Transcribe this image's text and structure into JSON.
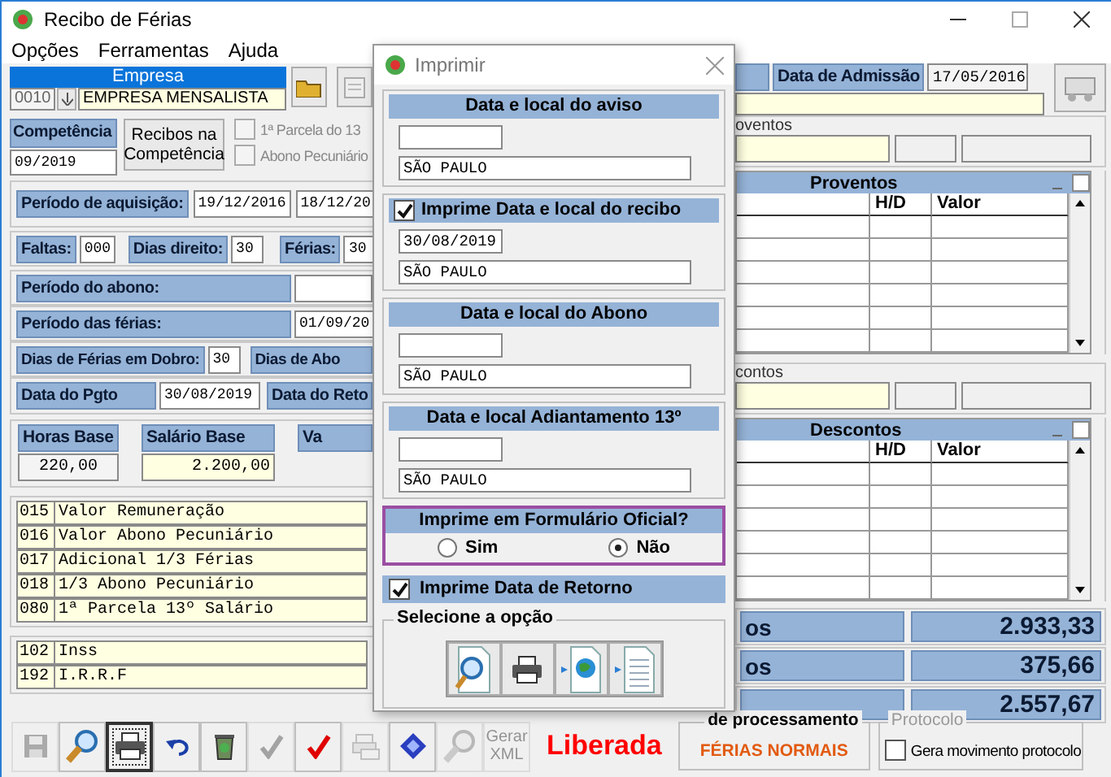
{
  "window": {
    "title": "Recibo de Férias"
  },
  "menu": [
    "Opções",
    "Ferramentas",
    "Ajuda"
  ],
  "empresa": {
    "label": "Empresa",
    "code": "0010",
    "name": "EMPRESA MENSALISTA"
  },
  "competencia": {
    "label": "Competência",
    "value": "09/2019",
    "button": "Recibos na Competência",
    "options": [
      {
        "label": "1ª Parcela do 13",
        "checked": false,
        "disabled": true
      },
      {
        "label": "Abono Pecuniário",
        "checked": false,
        "disabled": true
      }
    ]
  },
  "aquisicao": {
    "label": "Período de aquisição:",
    "start": "19/12/2016",
    "end": "18/12/20"
  },
  "dias": [
    {
      "label": "Faltas:",
      "value": "000"
    },
    {
      "label": "Dias direito:",
      "value": "30"
    },
    {
      "label": "Férias:",
      "value": "30"
    }
  ],
  "periodo_abono": {
    "label": "Período do abono:"
  },
  "periodo_ferias": {
    "label": "Período das férias:",
    "value": "01/09/20"
  },
  "dobro": {
    "label": "Dias de Férias em Dobro:",
    "value": "30",
    "next_label": "Dias de Abo"
  },
  "pagamento": {
    "label": "Data do Pgto",
    "value": "30/08/2019",
    "next_label": "Data do Reto"
  },
  "bases": [
    {
      "label": "Horas Base",
      "value": "220,00"
    },
    {
      "label": "Salário Base",
      "value": "2.200,00"
    },
    {
      "label": "Va"
    }
  ],
  "proventos_list": [
    {
      "code": "015",
      "description": "Valor Remuneração"
    },
    {
      "code": "016",
      "description": "Valor Abono Pecuniário"
    },
    {
      "code": "017",
      "description": "Adicional 1/3 Férias"
    },
    {
      "code": "018",
      "description": "1/3 Abono Pecuniário"
    },
    {
      "code": "080",
      "description": "1ª Parcela 13º Salário"
    }
  ],
  "descontos_list": [
    {
      "code": "102",
      "description": "Inss"
    },
    {
      "code": "192",
      "description": "I.R.R.F"
    }
  ],
  "admissao": {
    "label": "Data de Admissão",
    "value": "17/05/2016"
  },
  "proventos_group": {
    "legend": "oventos"
  },
  "proventos_table": {
    "title": "Proventos",
    "columns": [
      "H/D",
      "Valor"
    ]
  },
  "descontos_group": {
    "legend": "contos"
  },
  "descontos_table": {
    "title": "Descontos",
    "columns": [
      "H/D",
      "Valor"
    ]
  },
  "totals": [
    {
      "label": "os",
      "value": "2.933,33"
    },
    {
      "label": "os",
      "value": "375,66"
    },
    {
      "value": "2.557,67"
    }
  ],
  "toolbar": [
    {
      "kind": "save",
      "disabled": true,
      "selected": false
    },
    {
      "kind": "search",
      "disabled": false,
      "selected": false
    },
    {
      "kind": "print",
      "disabled": false,
      "selected": true
    },
    {
      "kind": "undo",
      "disabled": false,
      "selected": false
    },
    {
      "kind": "recycle",
      "disabled": false,
      "selected": false
    },
    {
      "kind": "check",
      "disabled": true,
      "selected": false
    },
    {
      "kind": "check",
      "disabled": false,
      "selected": false
    },
    {
      "kind": "printers",
      "disabled": true,
      "selected": false
    },
    {
      "kind": "diamond",
      "disabled": false,
      "selected": false
    },
    {
      "kind": "search",
      "disabled": true,
      "selected": false
    },
    {
      "kind": "text",
      "label": "Gerar XML",
      "disabled": true,
      "selected": false
    }
  ],
  "status": "Liberada",
  "processamento": {
    "legend": "de processamento",
    "value": "FÉRIAS NORMAIS"
  },
  "protocolo": {
    "legend": "Protocolo",
    "label": "Gera movimento protocolo",
    "checked": false
  },
  "dialog": {
    "title": "Imprimir",
    "sections": [
      {
        "kind": "plain",
        "title": "Data e local do aviso",
        "place": "SÃO PAULO"
      },
      {
        "kind": "check",
        "title": "Imprime Data e local do recibo",
        "checked": true,
        "date": "30/08/2019",
        "place": "SÃO PAULO"
      },
      {
        "kind": "plain",
        "title": "Data e local do Abono",
        "place": "SÃO PAULO"
      },
      {
        "kind": "plain",
        "title": "Data e local Adiantamento 13º",
        "place": "SÃO PAULO"
      }
    ],
    "formulario": {
      "title": "Imprime em Formulário Oficial?",
      "options": [
        {
          "label": "Sim",
          "selected": false
        },
        {
          "label": "Não",
          "selected": true
        }
      ]
    },
    "retorno": {
      "label": "Imprime Data de Retorno",
      "checked": true
    },
    "opcoes": {
      "legend": "Selecione a opção",
      "buttons": [
        {
          "kind": "preview"
        },
        {
          "kind": "print"
        },
        {
          "kind": "web"
        },
        {
          "kind": "document"
        }
      ]
    }
  }
}
